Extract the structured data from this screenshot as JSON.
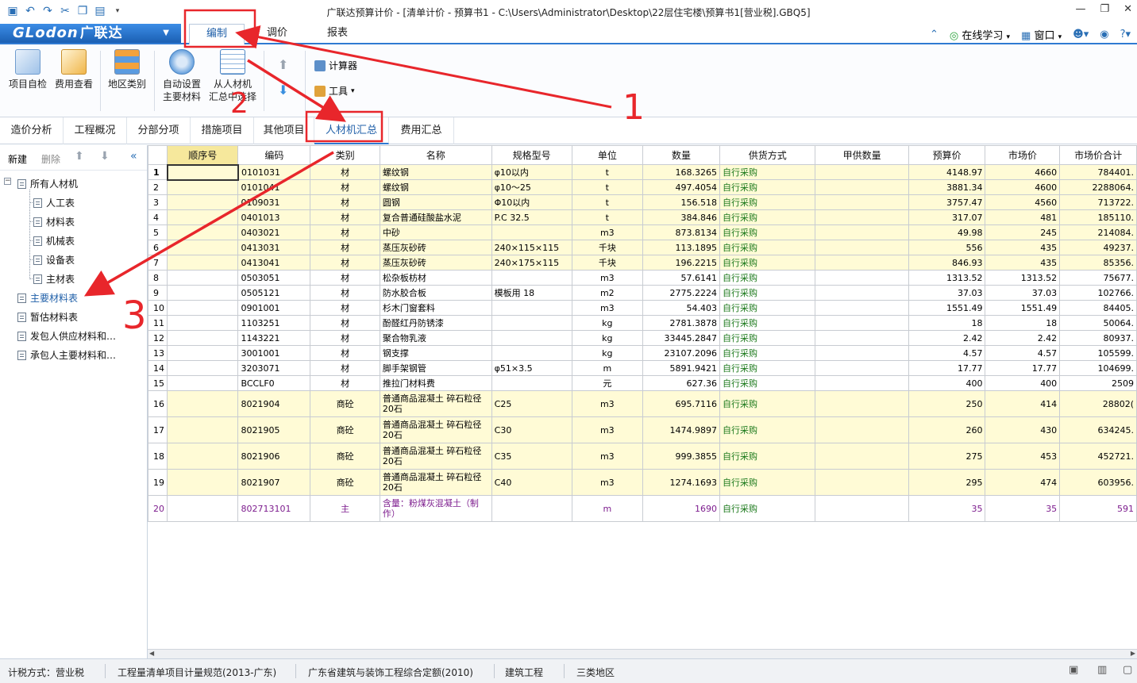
{
  "window": {
    "title": "广联达预算计价 - [清单计价 - 预算书1 - C:\\Users\\Administrator\\Desktop\\22层住宅楼\\预算书1[营业税].GBQ5]"
  },
  "logo": {
    "latin": "GLodon",
    "cn": "广联达"
  },
  "menu": {
    "tabs": [
      "编制",
      "调价",
      "报表"
    ],
    "online": "在线学习",
    "window": "窗口"
  },
  "ribbon": {
    "check": "项目自检",
    "fee_view": "费用查看",
    "region": "地区类别",
    "auto_set_1": "自动设置",
    "auto_set_2": "主要材料",
    "from_1": "从人材机",
    "from_2": "汇总中选择",
    "calculator": "计算器",
    "tools": "工具"
  },
  "subtabs": [
    "造价分析",
    "工程概况",
    "分部分项",
    "措施项目",
    "其他项目",
    "人材机汇总",
    "费用汇总"
  ],
  "left": {
    "new": "新建",
    "delete": "删除",
    "tree": [
      "所有人材机",
      "人工表",
      "材料表",
      "机械表",
      "设备表",
      "主材表",
      "主要材料表",
      "暂估材料表",
      "发包人供应材料和…",
      "承包人主要材料和…"
    ]
  },
  "grid": {
    "headers": [
      "顺序号",
      "编码",
      "类别",
      "名称",
      "规格型号",
      "单位",
      "数量",
      "供货方式",
      "甲供数量",
      "预算价",
      "市场价",
      "市场价合计"
    ],
    "rows": [
      {
        "n": "1",
        "code": "0101031",
        "cat": "材",
        "name": "螺纹钢",
        "spec": "φ10以内",
        "unit": "t",
        "qty": "168.3265",
        "supply": "自行采购",
        "jia": "",
        "bud": "4148.97",
        "mkt": "4660",
        "total": "784401."
      },
      {
        "n": "2",
        "code": "0101041",
        "cat": "材",
        "name": "螺纹钢",
        "spec": "φ10～25",
        "unit": "t",
        "qty": "497.4054",
        "supply": "自行采购",
        "jia": "",
        "bud": "3881.34",
        "mkt": "4600",
        "total": "2288064."
      },
      {
        "n": "3",
        "code": "0109031",
        "cat": "材",
        "name": "圆钢",
        "spec": "Φ10以内",
        "unit": "t",
        "qty": "156.518",
        "supply": "自行采购",
        "jia": "",
        "bud": "3757.47",
        "mkt": "4560",
        "total": "713722."
      },
      {
        "n": "4",
        "code": "0401013",
        "cat": "材",
        "name": "复合普通硅酸盐水泥",
        "spec": "P.C 32.5",
        "unit": "t",
        "qty": "384.846",
        "supply": "自行采购",
        "jia": "",
        "bud": "317.07",
        "mkt": "481",
        "total": "185110."
      },
      {
        "n": "5",
        "code": "0403021",
        "cat": "材",
        "name": "中砂",
        "spec": "",
        "unit": "m3",
        "qty": "873.8134",
        "supply": "自行采购",
        "jia": "",
        "bud": "49.98",
        "mkt": "245",
        "total": "214084."
      },
      {
        "n": "6",
        "code": "0413031",
        "cat": "材",
        "name": "蒸压灰砂砖",
        "spec": "240×115×115",
        "unit": "千块",
        "qty": "113.1895",
        "supply": "自行采购",
        "jia": "",
        "bud": "556",
        "mkt": "435",
        "total": "49237."
      },
      {
        "n": "7",
        "code": "0413041",
        "cat": "材",
        "name": "蒸压灰砂砖",
        "spec": "240×175×115",
        "unit": "千块",
        "qty": "196.2215",
        "supply": "自行采购",
        "jia": "",
        "bud": "846.93",
        "mkt": "435",
        "total": "85356."
      },
      {
        "n": "8",
        "code": "0503051",
        "cat": "材",
        "name": "松杂板枋材",
        "spec": "",
        "unit": "m3",
        "qty": "57.6141",
        "supply": "自行采购",
        "jia": "",
        "bud": "1313.52",
        "mkt": "1313.52",
        "total": "75677."
      },
      {
        "n": "9",
        "code": "0505121",
        "cat": "材",
        "name": "防水胶合板",
        "spec": "模板用 18",
        "unit": "m2",
        "qty": "2775.2224",
        "supply": "自行采购",
        "jia": "",
        "bud": "37.03",
        "mkt": "37.03",
        "total": "102766."
      },
      {
        "n": "10",
        "code": "0901001",
        "cat": "材",
        "name": "杉木门窗套料",
        "spec": "",
        "unit": "m3",
        "qty": "54.403",
        "supply": "自行采购",
        "jia": "",
        "bud": "1551.49",
        "mkt": "1551.49",
        "total": "84405."
      },
      {
        "n": "11",
        "code": "1103251",
        "cat": "材",
        "name": "酚醛红丹防锈漆",
        "spec": "",
        "unit": "kg",
        "qty": "2781.3878",
        "supply": "自行采购",
        "jia": "",
        "bud": "18",
        "mkt": "18",
        "total": "50064."
      },
      {
        "n": "12",
        "code": "1143221",
        "cat": "材",
        "name": "聚合物乳液",
        "spec": "",
        "unit": "kg",
        "qty": "33445.2847",
        "supply": "自行采购",
        "jia": "",
        "bud": "2.42",
        "mkt": "2.42",
        "total": "80937."
      },
      {
        "n": "13",
        "code": "3001001",
        "cat": "材",
        "name": "钢支撑",
        "spec": "",
        "unit": "kg",
        "qty": "23107.2096",
        "supply": "自行采购",
        "jia": "",
        "bud": "4.57",
        "mkt": "4.57",
        "total": "105599."
      },
      {
        "n": "14",
        "code": "3203071",
        "cat": "材",
        "name": "脚手架钢管",
        "spec": "φ51×3.5",
        "unit": "m",
        "qty": "5891.9421",
        "supply": "自行采购",
        "jia": "",
        "bud": "17.77",
        "mkt": "17.77",
        "total": "104699."
      },
      {
        "n": "15",
        "code": "BCCLF0",
        "cat": "材",
        "name": "推拉门材料费",
        "spec": "",
        "unit": "元",
        "qty": "627.36",
        "supply": "自行采购",
        "jia": "",
        "bud": "400",
        "mkt": "400",
        "total": "2509"
      },
      {
        "n": "16",
        "code": "8021904",
        "cat": "商砼",
        "name": "普通商品混凝土 碎石粒径20石",
        "spec": "C25",
        "unit": "m3",
        "qty": "695.7116",
        "supply": "自行采购",
        "jia": "",
        "bud": "250",
        "mkt": "414",
        "total": "28802("
      },
      {
        "n": "17",
        "code": "8021905",
        "cat": "商砼",
        "name": "普通商品混凝土 碎石粒径20石",
        "spec": "C30",
        "unit": "m3",
        "qty": "1474.9897",
        "supply": "自行采购",
        "jia": "",
        "bud": "260",
        "mkt": "430",
        "total": "634245."
      },
      {
        "n": "18",
        "code": "8021906",
        "cat": "商砼",
        "name": "普通商品混凝土 碎石粒径20石",
        "spec": "C35",
        "unit": "m3",
        "qty": "999.3855",
        "supply": "自行采购",
        "jia": "",
        "bud": "275",
        "mkt": "453",
        "total": "452721."
      },
      {
        "n": "19",
        "code": "8021907",
        "cat": "商砼",
        "name": "普通商品混凝土 碎石粒径20石",
        "spec": "C40",
        "unit": "m3",
        "qty": "1274.1693",
        "supply": "自行采购",
        "jia": "",
        "bud": "295",
        "mkt": "474",
        "total": "603956."
      },
      {
        "n": "20",
        "code": "802713101",
        "cat": "主",
        "name": "含量：粉煤灰混凝土（制作）",
        "spec": "",
        "unit": "m",
        "qty": "1690",
        "supply": "自行采购",
        "jia": "",
        "bud": "35",
        "mkt": "35",
        "total": "591"
      }
    ]
  },
  "status": {
    "tax": "计税方式：营业税",
    "spec": "工程量清单项目计量规范(2013-广东)",
    "quota": "广东省建筑与装饰工程综合定额(2010)",
    "type": "建筑工程",
    "region": "三类地区"
  },
  "annotations": {
    "n1": "1",
    "n2": "2",
    "n3": "3"
  },
  "colors": {
    "accent": "#2f7ad2",
    "yellow_row": "#fffbd6",
    "header_hl": "#f6e89c",
    "annotation": "#e8262b"
  }
}
